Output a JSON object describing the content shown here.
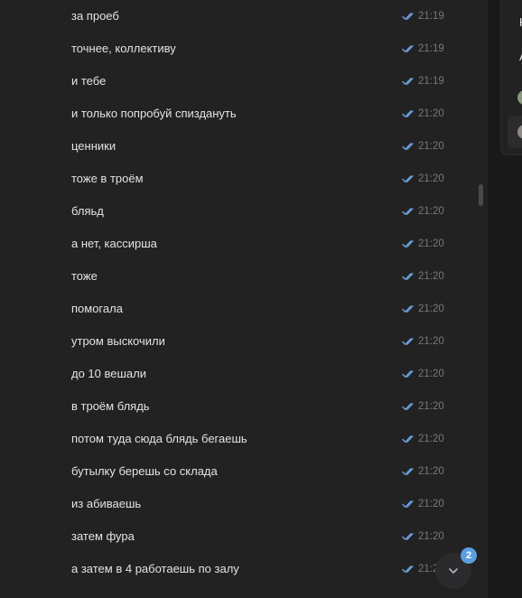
{
  "messages": [
    {
      "text": "за проеб",
      "time": "21:19"
    },
    {
      "text": "точнее, коллективу",
      "time": "21:19"
    },
    {
      "text": "и тебе",
      "time": "21:19"
    },
    {
      "text": "и только попробуй спиздануть",
      "time": "21:20"
    },
    {
      "text": "ценники",
      "time": "21:20"
    },
    {
      "text": "тоже в троём",
      "time": "21:20"
    },
    {
      "text": "бляьд",
      "time": "21:20"
    },
    {
      "text": "а нет, кассирша",
      "time": "21:20"
    },
    {
      "text": "тоже",
      "time": "21:20"
    },
    {
      "text": "помогала",
      "time": "21:20"
    },
    {
      "text": "утром выскочили",
      "time": "21:20"
    },
    {
      "text": "до 10 вешали",
      "time": "21:20"
    },
    {
      "text": "в троём блядь",
      "time": "21:20"
    },
    {
      "text": "потом туда сюда блядь бегаешь",
      "time": "21:20"
    },
    {
      "text": "бутылку берешь со склада",
      "time": "21:20"
    },
    {
      "text": "из абиваешь",
      "time": "21:20"
    },
    {
      "text": "затем фура",
      "time": "21:20"
    },
    {
      "text": "а затем в 4 работаешь по залу",
      "time": "21:2"
    }
  ],
  "scroll_down": {
    "unread_count": "2",
    "icon": "chevron-down-icon"
  },
  "right_panel": {
    "items": [
      {
        "text": "Н"
      },
      {
        "text": "А"
      }
    ],
    "avatars": [
      {
        "color": "#8a9a7a"
      },
      {
        "color": "#8e8a86"
      }
    ]
  },
  "colors": {
    "background": "#222222",
    "text": "#e1e3e6",
    "time": "#76787a",
    "read_ticks": "#71aaeb",
    "badge": "#5b9ee0"
  }
}
